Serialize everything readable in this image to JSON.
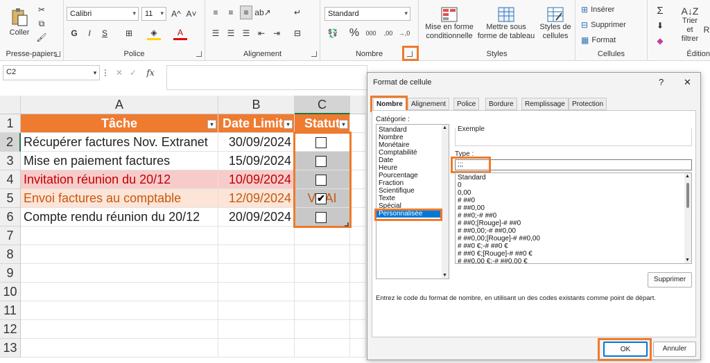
{
  "ribbon": {
    "clipboard": {
      "paste": "Coller",
      "label": "Presse-papiers"
    },
    "font": {
      "name": "Calibri",
      "size": "11",
      "label": "Police",
      "bold": "G",
      "italic": "I",
      "underline": "S",
      "grow": "A^",
      "shrink": "A˅",
      "font_color": "A"
    },
    "alignment": {
      "label": "Alignement"
    },
    "number": {
      "format": "Standard",
      "label": "Nombre",
      "percent": "%",
      "thousands": "000",
      "inc_dec": ",00",
      "dec_dec": "→,0"
    },
    "styles": {
      "conditional": "Mise en forme conditionnelle",
      "as_table": "Mettre sous forme de tableau",
      "cell_styles": "Styles de cellules",
      "label": "Styles"
    },
    "cells": {
      "insert": "Insérer",
      "delete": "Supprimer",
      "format": "Format",
      "label": "Cellules"
    },
    "editing": {
      "sum": "Σ",
      "sort": "Trier et filtrer",
      "find": "R",
      "label": "Édition"
    }
  },
  "formula_bar": {
    "name_box": "C2",
    "fx": "fx"
  },
  "sheet": {
    "columns": [
      "A",
      "B",
      "C"
    ],
    "rows": [
      "1",
      "2",
      "3",
      "4",
      "5",
      "6",
      "7",
      "8",
      "9",
      "10",
      "11",
      "12",
      "13"
    ],
    "headers": [
      "Tâche",
      "Date Limite",
      "Statut"
    ],
    "data": [
      {
        "task": "Récupérer factures Nov. Extranet",
        "date": "30/09/2024",
        "status": ""
      },
      {
        "task": "Mise en paiement factures",
        "date": "15/09/2024",
        "status": ""
      },
      {
        "task": "Invitation réunion du 20/12",
        "date": "10/09/2024",
        "status": ""
      },
      {
        "task": "Envoi factures au comptable",
        "date": "12/09/2024",
        "status": "VRAI"
      },
      {
        "task": "Compte rendu réunion du 20/12",
        "date": "20/09/2024",
        "status": ""
      }
    ]
  },
  "dialog": {
    "title": "Format de cellule",
    "help": "?",
    "close": "✕",
    "tabs": [
      "Nombre",
      "Alignement",
      "Police",
      "Bordure",
      "Remplissage",
      "Protection"
    ],
    "category_label": "Catégorie :",
    "categories": [
      "Standard",
      "Nombre",
      "Monétaire",
      "Comptabilité",
      "Date",
      "Heure",
      "Pourcentage",
      "Fraction",
      "Scientifique",
      "Texte",
      "Spécial",
      "Personnalisée"
    ],
    "selected_category": "Personnalisée",
    "sample_label": "Exemple",
    "type_label": "Type :",
    "type_value": ";;;",
    "formats": [
      "Standard",
      "0",
      "0,00",
      "# ##0",
      "# ##0,00",
      "# ##0;-# ##0",
      "# ##0;[Rouge]-# ##0",
      "# ##0,00;-# ##0,00",
      "# ##0,00;[Rouge]-# ##0,00",
      "# ##0 €;-# ##0 €",
      "# ##0 €;[Rouge]-# ##0 €",
      "# ##0,00 €;-# ##0,00 €"
    ],
    "delete_button": "Supprimer",
    "hint": "Entrez le code du format de nombre, en utilisant un des codes existants comme point de départ.",
    "ok": "OK",
    "cancel": "Annuler"
  },
  "colors": {
    "accent": "#EF7B31",
    "highlight": "#EF7A2A",
    "row_pink": "#F8CBCB",
    "row_peach": "#FCE4D6",
    "red_text": "#C00000",
    "orange_text": "#C65911",
    "status_gray": "#C8C8C8"
  }
}
